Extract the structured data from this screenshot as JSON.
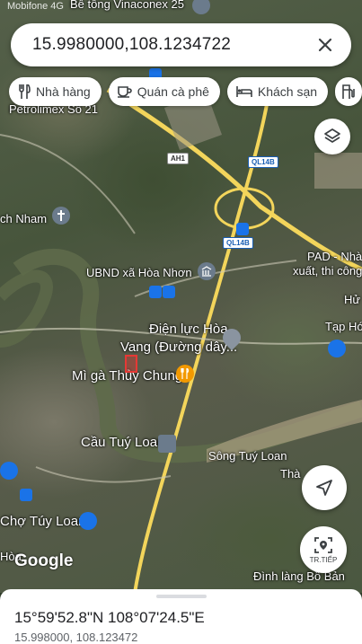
{
  "status_bar": {
    "left_text": "Mobifone 4G"
  },
  "search": {
    "query": "15.9980000,108.1234722"
  },
  "chips": [
    {
      "label": "Nhà hàng",
      "icon": "fork-knife-icon"
    },
    {
      "label": "Quán cà phê",
      "icon": "coffee-cup-icon"
    },
    {
      "label": "Khách sạn",
      "icon": "bed-icon"
    },
    {
      "label": "",
      "icon": "gas-station-icon"
    }
  ],
  "map_labels": {
    "top": "Bê tông Vinaconex 25",
    "petrolimex": "Petrolimex Số 21",
    "nham": "ch Nham",
    "ubnd": "UBND xã Hòa Nhơn",
    "dien_luc_1": "Điện lực Hòa",
    "dien_luc_2": "Vang (Đường dây...",
    "mi_ga": "Mì gà Thủy Chung",
    "cau": "Cầu Tuý Loan",
    "song": "Sông Tuý Loan",
    "cho": "Chợ Túy Loan",
    "pad_1": "PAD - Nhà",
    "pad_2": "xuất, thi công",
    "tap_hoa": "Tạp Hó",
    "hu": "Hử",
    "tha": "Thà",
    "dinh_lang": "Đình làng Bồ Bản",
    "hoa": "Hòa",
    "google": "Google"
  },
  "road_shields": {
    "ah1": "AH1",
    "ql14b_1": "QL14B",
    "ql14b_2": "QL14B"
  },
  "buttons": {
    "start_label": "TR.TIẾP"
  },
  "place": {
    "coords_dms": "15°59'52.8\"N 108°07'24.5\"E",
    "coords_decimal": "15.998000, 108.123472"
  },
  "colors": {
    "road_yellow": "#f3d55b",
    "accent_blue": "#1a73e8",
    "pin_red": "#e53935",
    "poi_orange": "#f29900"
  }
}
